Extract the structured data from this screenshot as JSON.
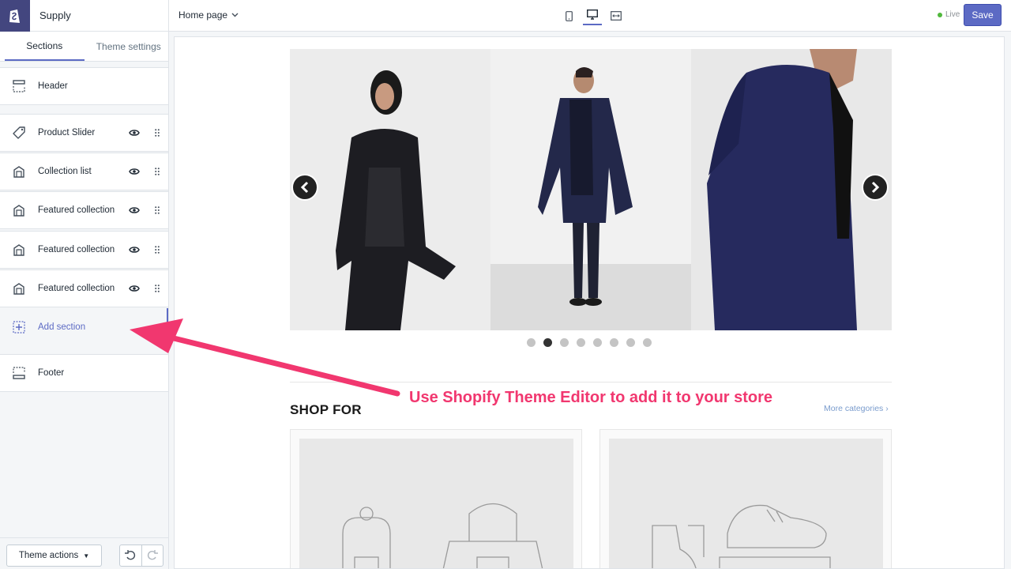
{
  "sidebar": {
    "store_name": "Supply",
    "tabs": [
      {
        "label": "Sections",
        "active": true
      },
      {
        "label": "Theme settings",
        "active": false
      }
    ],
    "header_label": "Header",
    "sections": [
      {
        "label": "Product Slider",
        "icon": "tag-icon"
      },
      {
        "label": "Collection list",
        "icon": "collection-icon"
      },
      {
        "label": "Featured collection",
        "icon": "collection-icon"
      },
      {
        "label": "Featured collection",
        "icon": "collection-icon"
      },
      {
        "label": "Featured collection",
        "icon": "collection-icon"
      }
    ],
    "add_section_label": "Add section",
    "footer_label": "Footer",
    "theme_actions_label": "Theme actions",
    "accent_color": "#5c6ac4"
  },
  "topbar": {
    "page_select": "Home page",
    "devices": [
      "mobile-icon",
      "desktop-icon",
      "fullwidth-icon"
    ],
    "active_device": "desktop-icon",
    "status": "Live",
    "save_label": "Save"
  },
  "preview": {
    "slider_dots": 8,
    "active_dot": 2,
    "section_title": "SHOP FOR",
    "more_link": "More categories ›"
  },
  "annotation": {
    "text": "Use Shopify Theme Editor to add it to your store",
    "color": "#f1376f"
  }
}
